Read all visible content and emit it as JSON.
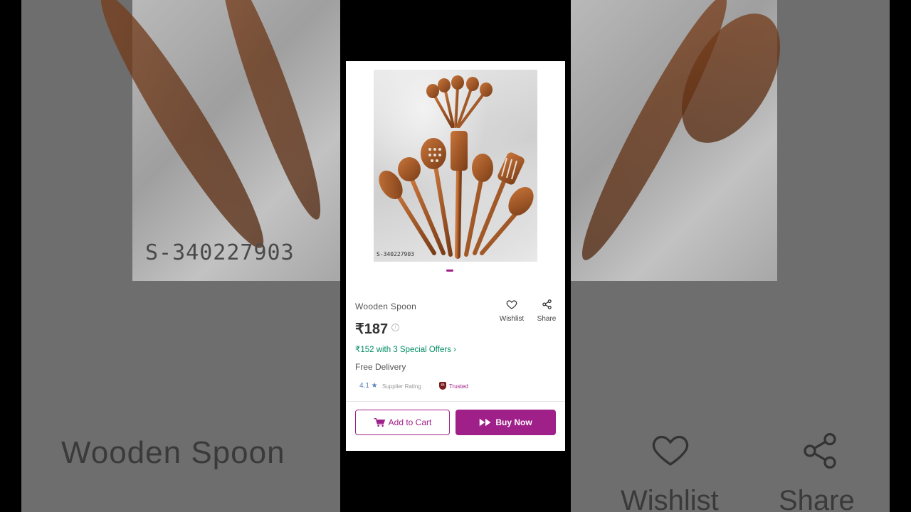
{
  "product": {
    "image_code": "S-340227903",
    "title": "Wooden Spoon",
    "price": "₹187",
    "offer": "₹152 with 3 Special Offers ›",
    "delivery": "Free Delivery",
    "rating": "4.1 ★",
    "rating_label": "Supplier Rating",
    "trusted_label": "Trusted"
  },
  "actions": {
    "wishlist_label": "Wishlist",
    "share_label": "Share"
  },
  "buttons": {
    "add_to_cart": "Add to Cart",
    "buy_now": "Buy Now"
  },
  "background": {
    "image_code": "S-340227903",
    "title": "Wooden Spoon",
    "wishlist_label": "Wishlist",
    "share_label": "Share"
  },
  "colors": {
    "brand": "#9f2089",
    "offer": "#038d63"
  },
  "carousel": {
    "current_slide": 1
  }
}
